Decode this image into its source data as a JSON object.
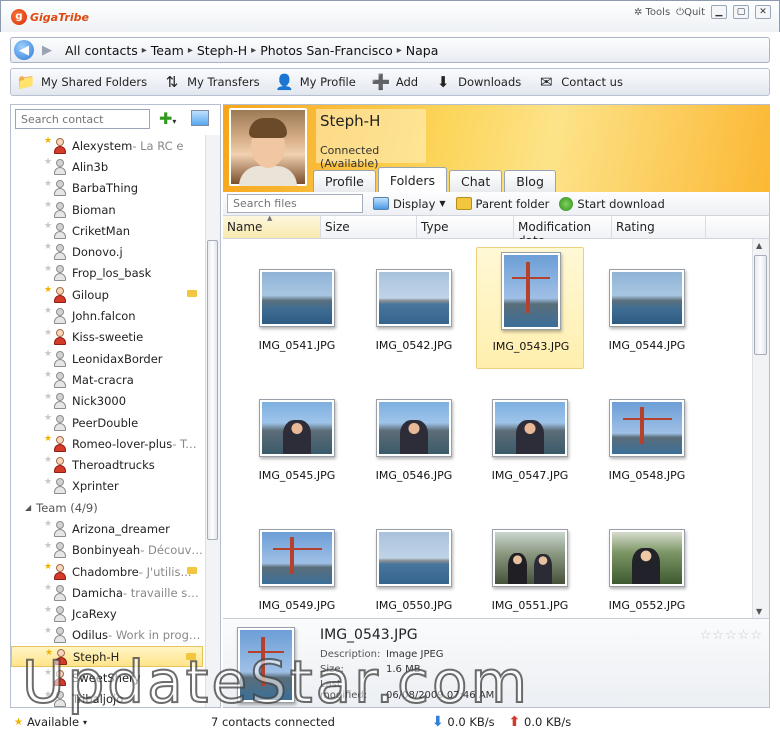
{
  "app": {
    "logo_text": "GigaTribe",
    "tools_label": "Tools",
    "quit_label": "Quit"
  },
  "breadcrumb": [
    "All contacts",
    "Team",
    "Steph-H",
    "Photos San-Francisco",
    "Napa"
  ],
  "toolbar": {
    "shared_folders": "My Shared Folders",
    "transfers": "My Transfers",
    "profile": "My Profile",
    "add": "Add",
    "downloads": "Downloads",
    "contact_us": "Contact us"
  },
  "sidebar": {
    "search_placeholder": "Search contact",
    "contacts": [
      {
        "name": "Alexystem",
        "status": " - La RC e",
        "star": true,
        "red": true,
        "folder": false
      },
      {
        "name": "Alin3b",
        "status": "",
        "star": false,
        "red": false,
        "folder": false
      },
      {
        "name": "BarbaThing",
        "status": "",
        "star": false,
        "red": false,
        "folder": false
      },
      {
        "name": "Bioman",
        "status": "",
        "star": false,
        "red": false,
        "folder": false
      },
      {
        "name": "CriketMan",
        "status": "",
        "star": false,
        "red": false,
        "folder": false
      },
      {
        "name": "Donovo.j",
        "status": "",
        "star": false,
        "red": false,
        "folder": false
      },
      {
        "name": "Frop_los_bask",
        "status": "",
        "star": false,
        "red": false,
        "folder": false
      },
      {
        "name": "Giloup",
        "status": "",
        "star": true,
        "red": true,
        "folder": true
      },
      {
        "name": "John.falcon",
        "status": "",
        "star": false,
        "red": false,
        "folder": false
      },
      {
        "name": "Kiss-sweetie",
        "status": "",
        "star": false,
        "red": true,
        "folder": false
      },
      {
        "name": "LeonidaxBorder",
        "status": "",
        "star": false,
        "red": false,
        "folder": false
      },
      {
        "name": "Mat-cracra",
        "status": "",
        "star": false,
        "red": false,
        "folder": false
      },
      {
        "name": "Nick3000",
        "status": "",
        "star": false,
        "red": false,
        "folder": false
      },
      {
        "name": "PeerDouble",
        "status": "",
        "star": false,
        "red": false,
        "folder": false
      },
      {
        "name": "Romeo-lover-plus",
        "status": " - Tes...",
        "star": true,
        "red": true,
        "folder": false
      },
      {
        "name": "Theroadtrucks",
        "status": "",
        "star": false,
        "red": true,
        "folder": false
      },
      {
        "name": "Xprinter",
        "status": "",
        "star": false,
        "red": false,
        "folder": false
      }
    ],
    "group_team": "Team (4/9)",
    "team": [
      {
        "name": "Arizona_dreamer",
        "status": "",
        "star": false,
        "red": false,
        "folder": false
      },
      {
        "name": "Bonbinyeah",
        "status": " - Découvr...",
        "star": false,
        "red": false,
        "folder": false
      },
      {
        "name": "Chadombre",
        "status": " - J'utilis...",
        "star": true,
        "red": true,
        "folder": true
      },
      {
        "name": "Damicha",
        "status": " - travaille sur ...",
        "star": false,
        "red": false,
        "folder": false
      },
      {
        "name": "JcaRexy",
        "status": "",
        "star": false,
        "red": false,
        "folder": false
      },
      {
        "name": "Odilus",
        "status": " - Work in progr...",
        "star": false,
        "red": false,
        "folder": false
      },
      {
        "name": "Steph-H",
        "status": "",
        "star": true,
        "red": true,
        "folder": true,
        "selected": true
      },
      {
        "name": "SweetShery",
        "status": "",
        "star": false,
        "red": true,
        "folder": false
      },
      {
        "name": "Tribaljojo",
        "status": "",
        "star": false,
        "red": false,
        "folder": false
      }
    ]
  },
  "profile": {
    "name": "Steph-H",
    "status": "Connected (Available)",
    "tabs": [
      "Profile",
      "Folders",
      "Chat",
      "Blog"
    ],
    "active_tab": 1
  },
  "folder_toolbar": {
    "search_placeholder": "Search files",
    "display": "Display",
    "parent_folder": "Parent folder",
    "start_download": "Start download"
  },
  "columns": [
    "Name",
    "Size",
    "Type",
    "Modification date",
    "Rating"
  ],
  "files": [
    {
      "name": "IMG_0541.JPG",
      "kind": "sea"
    },
    {
      "name": "IMG_0542.JPG",
      "kind": "sea2"
    },
    {
      "name": "IMG_0543.JPG",
      "kind": "bridge",
      "portrait": true,
      "selected": true
    },
    {
      "name": "IMG_0544.JPG",
      "kind": "sea"
    },
    {
      "name": "IMG_0545.JPG",
      "kind": "people"
    },
    {
      "name": "IMG_0546.JPG",
      "kind": "people"
    },
    {
      "name": "IMG_0547.JPG",
      "kind": "people"
    },
    {
      "name": "IMG_0548.JPG",
      "kind": "bridge"
    },
    {
      "name": "IMG_0549.JPG",
      "kind": "bridge"
    },
    {
      "name": "IMG_0550.JPG",
      "kind": "sea2"
    },
    {
      "name": "IMG_0551.JPG",
      "kind": "street"
    },
    {
      "name": "IMG_0552.JPG",
      "kind": "garden"
    }
  ],
  "details": {
    "filename": "IMG_0543.JPG",
    "description_label": "Description:",
    "description": "Image JPEG",
    "size_label": "Size:",
    "size": "1.6 MB",
    "modified_label": "Last modified:",
    "modified": "06/08/2009 07:46 AM"
  },
  "status": {
    "availability": "Available",
    "contacts_connected": "7 contacts connected",
    "download_rate": "0.0 KB/s",
    "upload_rate": "0.0 KB/s"
  },
  "watermark": "UpdateStar.com"
}
